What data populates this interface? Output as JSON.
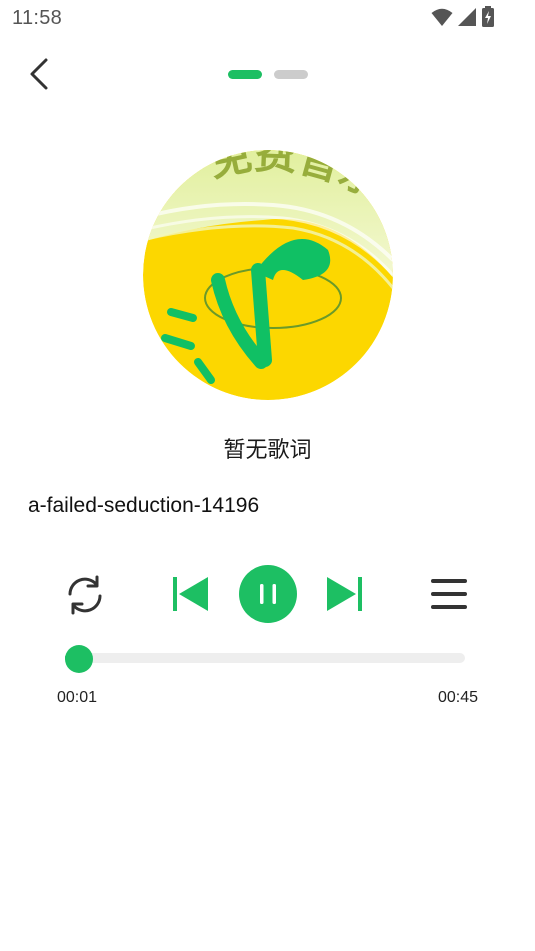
{
  "status_bar": {
    "time": "11:58",
    "icons": [
      "wifi-icon",
      "signal-icon",
      "battery-charging-icon"
    ]
  },
  "header": {
    "back_icon": "chevron-left-icon",
    "pages": [
      {
        "active": true
      },
      {
        "active": false
      }
    ]
  },
  "cover": {
    "logo_text": "免费音乐",
    "colors": {
      "yellow": "#fcd700",
      "green": "#10c064",
      "light_green": "#e7f2a7"
    }
  },
  "player": {
    "lyrics": "暂无歌词",
    "song_title": "a-failed-seduction-14196",
    "controls": {
      "repeat_icon": "repeat-icon",
      "prev_icon": "skip-previous-icon",
      "play_pause_icon": "pause-icon",
      "next_icon": "skip-next-icon",
      "playlist_icon": "playlist-menu-icon"
    },
    "progress": {
      "fraction": 0.022,
      "current_time": "00:01",
      "total_time": "00:45"
    }
  },
  "colors": {
    "accent": "#1dbf63",
    "track": "#eeeeee",
    "icon_dark": "#333333"
  }
}
